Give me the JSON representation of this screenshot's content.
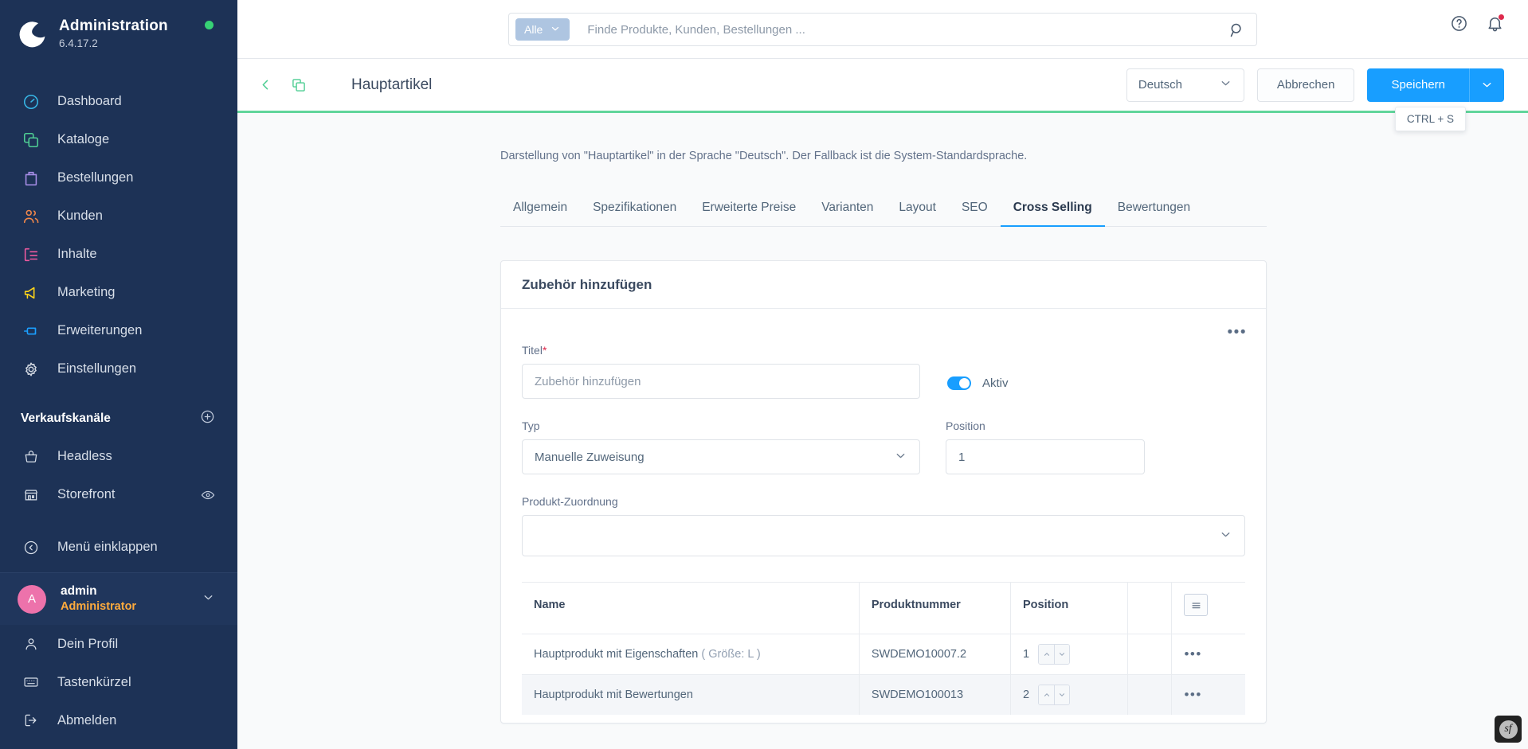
{
  "sidebar": {
    "title": "Administration",
    "version": "6.4.17.2",
    "status_icon": "status-dot",
    "nav": [
      {
        "label": "Dashboard",
        "icon": "dashboard-icon",
        "color": "#37b6e6"
      },
      {
        "label": "Kataloge",
        "icon": "catalog-icon",
        "color": "#4fce94"
      },
      {
        "label": "Bestellungen",
        "icon": "orders-icon",
        "color": "#a88ee8"
      },
      {
        "label": "Kunden",
        "icon": "customers-icon",
        "color": "#f2874a"
      },
      {
        "label": "Inhalte",
        "icon": "content-icon",
        "color": "#ef5aa0"
      },
      {
        "label": "Marketing",
        "icon": "marketing-icon",
        "color": "#ffd519"
      },
      {
        "label": "Erweiterungen",
        "icon": "extensions-icon",
        "color": "#1b9fff"
      },
      {
        "label": "Einstellungen",
        "icon": "settings-gear-icon",
        "color": "#d4dae3"
      }
    ],
    "channels_title": "Verkaufskanäle",
    "channels_add_icon": "plus-circle-icon",
    "channels": [
      {
        "label": "Headless",
        "icon": "basket-icon"
      },
      {
        "label": "Storefront",
        "icon": "store-icon",
        "right_icon": "eye-icon"
      }
    ],
    "collapse": {
      "label": "Menü einklappen",
      "icon": "collapse-left-icon"
    },
    "user": {
      "initial": "A",
      "name": "admin",
      "role": "Administrator",
      "caret_icon": "chevron-down-icon"
    },
    "user_menu": [
      {
        "label": "Dein Profil",
        "icon": "user-icon"
      },
      {
        "label": "Tastenkürzel",
        "icon": "keyboard-icon"
      },
      {
        "label": "Abmelden",
        "icon": "logout-icon"
      }
    ]
  },
  "topbar": {
    "scope_label": "Alle",
    "scope_caret_icon": "chevron-down-icon",
    "search_placeholder": "Finde Produkte, Kunden, Bestellungen ...",
    "search_value": "",
    "search_icon": "search-icon",
    "help_icon": "question-circle-icon",
    "notification_icon": "bell-icon",
    "notification_badge": true
  },
  "smartbar": {
    "back_icon": "chevron-left-icon",
    "duplicate_icon": "copy-icon",
    "title": "Hauptartikel",
    "language": "Deutsch",
    "language_caret_icon": "chevron-down-icon",
    "cancel_label": "Abbrechen",
    "save_label": "Speichern",
    "save_caret_icon": "chevron-down-icon",
    "tooltip": "CTRL + S"
  },
  "content": {
    "language_note": "Darstellung von \"Hauptartikel\" in der Sprache \"Deutsch\". Der Fallback ist die System-Standardsprache.",
    "tabs": [
      {
        "label": "Allgemein",
        "active": false
      },
      {
        "label": "Spezifikationen",
        "active": false
      },
      {
        "label": "Erweiterte Preise",
        "active": false
      },
      {
        "label": "Varianten",
        "active": false
      },
      {
        "label": "Layout",
        "active": false
      },
      {
        "label": "SEO",
        "active": false
      },
      {
        "label": "Cross Selling",
        "active": true
      },
      {
        "label": "Bewertungen",
        "active": false
      }
    ],
    "card": {
      "heading": "Zubehör hinzufügen",
      "context_menu_icon": "ellipsis-icon",
      "fields": {
        "title_label": "Titel",
        "title_required": "*",
        "title_value": "Zubehör hinzufügen",
        "title_placeholder": "Zubehör hinzufügen",
        "active_label": "Aktiv",
        "active_on": true,
        "type_label": "Typ",
        "type_value": "Manuelle Zuweisung",
        "position_label": "Position",
        "position_value": "1",
        "assignment_label": "Produkt-Zuordnung",
        "assignment_value": ""
      },
      "table": {
        "columns": [
          "Name",
          "Produktnummer",
          "Position"
        ],
        "settings_icon": "list-settings-icon",
        "rows": [
          {
            "name": "Hauptprodukt mit Eigenschaften",
            "variant": "( Größe: L )",
            "product_number": "SWDEMO10007.2",
            "position": "1",
            "actions_icon": "ellipsis-icon"
          },
          {
            "name": "Hauptprodukt mit Bewertungen",
            "variant": "",
            "product_number": "SWDEMO100013",
            "position": "2",
            "actions_icon": "ellipsis-icon"
          }
        ]
      }
    }
  },
  "debug_toolbar": {
    "label": "sf",
    "icon": "symfony-icon"
  },
  "colors": {
    "sidebar_bg": "#1d3256",
    "accent_blue": "#189eff",
    "accent_green": "#62d59b",
    "danger": "#de294c",
    "warning": "#ffab3d"
  }
}
